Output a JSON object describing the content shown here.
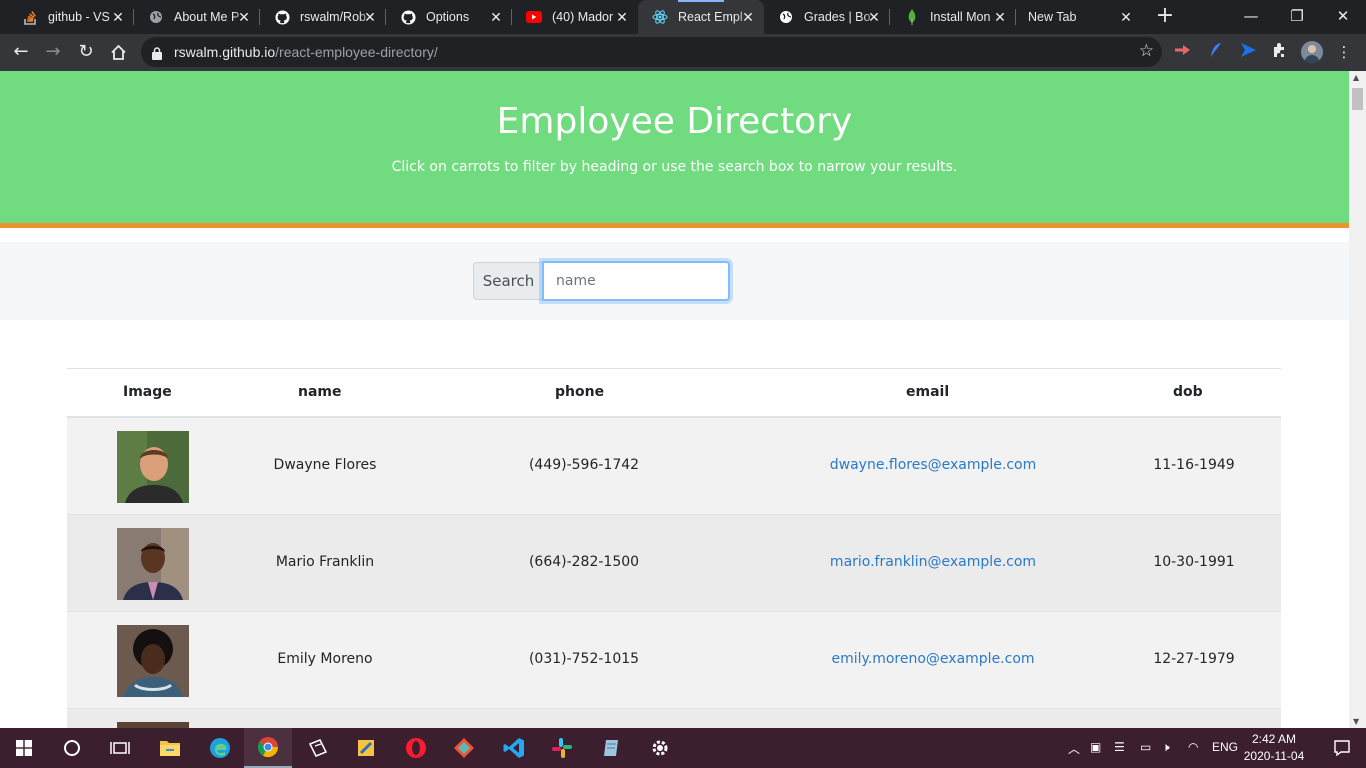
{
  "browser": {
    "tabs": [
      {
        "label": "github - VS",
        "icon": "stackoverflow-icon",
        "color": "#f48024"
      },
      {
        "label": "About Me P",
        "icon": "globe-icon",
        "color": "#9aa0a6"
      },
      {
        "label": "rswalm/Rob",
        "icon": "github-icon",
        "color": "#ffffff"
      },
      {
        "label": "Options",
        "icon": "github-icon",
        "color": "#ffffff"
      },
      {
        "label": "(40) Mador",
        "icon": "youtube-icon",
        "color": "#ff0000"
      },
      {
        "label": "React Empl",
        "icon": "react-icon",
        "color": "#61dafb",
        "active": true
      },
      {
        "label": "Grades | Bo",
        "icon": "globe-icon",
        "color": "#ffffff"
      },
      {
        "label": "Install Mon",
        "icon": "mongodb-leaf-icon",
        "color": "#4db33d"
      },
      {
        "label": "New Tab",
        "icon": "",
        "color": ""
      }
    ],
    "url_host": "rswalm.github.io",
    "url_path": "/react-employee-directory/"
  },
  "hero": {
    "title": "Employee Directory",
    "subtitle": "Click on carrots to filter by heading or use the search box to narrow your results."
  },
  "search": {
    "label": "Search",
    "placeholder": "name"
  },
  "table": {
    "headers": [
      "Image",
      "name",
      "phone",
      "email",
      "dob"
    ],
    "rows": [
      {
        "name": "Dwayne Flores",
        "phone": "(449)-596-1742",
        "email": "dwayne.flores@example.com",
        "dob": "11-16-1949",
        "avatar": {
          "bg": "#4d6a3a",
          "skin": "#d9a07a",
          "hair": "#5a3a24",
          "shirt": "#2b2b2b"
        }
      },
      {
        "name": "Mario Franklin",
        "phone": "(664)-282-1500",
        "email": "mario.franklin@example.com",
        "dob": "10-30-1991",
        "avatar": {
          "bg": "#8a7b72",
          "skin": "#5a3622",
          "hair": "#1c120c",
          "shirt": "#2c2f4a"
        }
      },
      {
        "name": "Emily Moreno",
        "phone": "(031)-752-1015",
        "email": "emily.moreno@example.com",
        "dob": "12-27-1979",
        "avatar": {
          "bg": "#6d5a4f",
          "skin": "#4a2c1c",
          "hair": "#151010",
          "shirt": "#3c5f7a"
        }
      }
    ]
  },
  "taskbar": {
    "clock_time": "2:42 AM",
    "clock_date": "2020-11-04",
    "language": "ENG"
  }
}
